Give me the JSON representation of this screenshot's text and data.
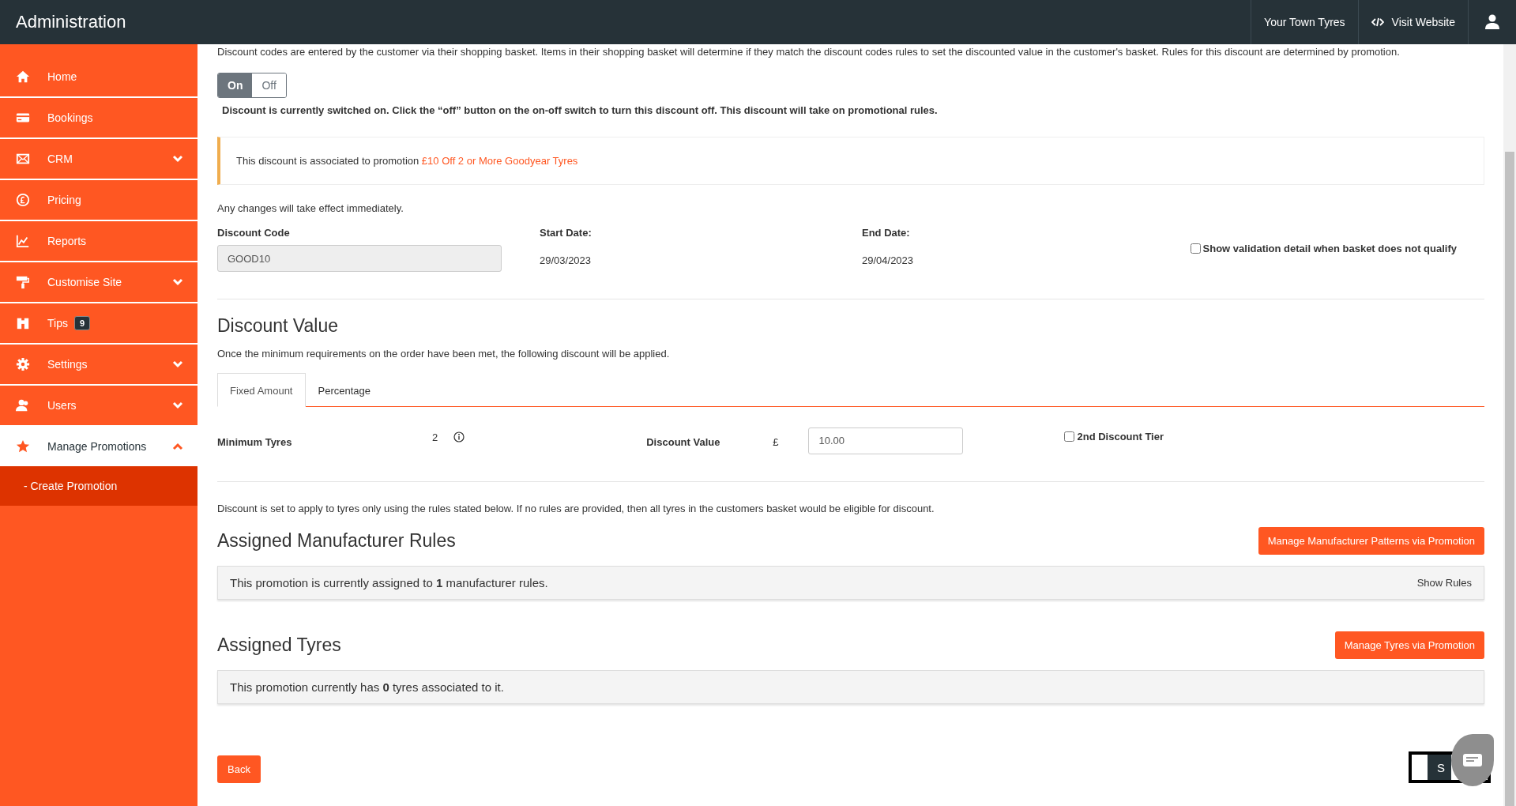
{
  "header": {
    "title": "Administration",
    "links": [
      {
        "label": "Your Town Tyres"
      },
      {
        "label": "Visit Website"
      }
    ]
  },
  "sidebar": [
    {
      "label": "Home",
      "selected": false
    },
    {
      "label": "Bookings",
      "selected": false
    },
    {
      "label": "CRM",
      "selected": false,
      "expanded": false
    },
    {
      "label": "Pricing",
      "selected": false
    },
    {
      "label": "Reports",
      "selected": false
    },
    {
      "label": "Customise Site",
      "selected": false,
      "expanded": false
    },
    {
      "label": "Tips",
      "selected": false,
      "badge": "9"
    },
    {
      "label": "Settings",
      "selected": false,
      "expanded": false
    },
    {
      "label": "Users",
      "selected": false,
      "expanded": false
    },
    {
      "label": "Manage Promotions",
      "selected": true,
      "expanded": true,
      "children": [
        {
          "label": "- Create Promotion",
          "selected": true
        }
      ]
    }
  ],
  "intro": "Discount codes are entered by the customer via their shopping basket. Items in their shopping basket will determine if they match the discount codes rules to set the discounted value in the customer's basket. Rules for this discount are determined by promotion.",
  "toggle": [
    {
      "label": "On",
      "selected": true
    },
    {
      "label": "Off",
      "selected": false
    }
  ],
  "toggle_note": "Discount is currently switched on. Click the “off” button on the on-off switch to turn this discount off. This discount will take on promotional rules.",
  "alert": {
    "text": "This discount is associated to promotion",
    "link": "£10 Off 2 or More Goodyear Tyres"
  },
  "changes_note": "Any changes will take effect immediately.",
  "discount_code": {
    "label": "Discount Code",
    "value": "GOOD10"
  },
  "start_date": {
    "label": "Start Date:",
    "value": "29/03/2023"
  },
  "end_date": {
    "label": "End Date:",
    "value": "29/04/2023"
  },
  "validation_checkbox": {
    "label": "Show validation detail when basket does not qualify",
    "checked": false
  },
  "discount_value": {
    "title": "Discount Value",
    "description": "Once the minimum requirements on the order have been met, the following discount will be applied.",
    "tabs": [
      {
        "label": "Fixed Amount",
        "selected": true
      },
      {
        "label": "Percentage",
        "selected": false
      }
    ],
    "minimum_tyres": {
      "label": "Minimum Tyres",
      "value": "2"
    },
    "value_field": {
      "label": "Discount Value",
      "currency": "£",
      "value": "10.00"
    },
    "second_tier": {
      "label": "2nd Discount Tier",
      "checked": false
    }
  },
  "rules_note": "Discount is set to apply to tyres only using the rules stated below. If no rules are provided, then all tyres in the customers basket would be eligible for discount.",
  "sections": [
    {
      "title": "Assigned Manufacturer Rules",
      "button": "Manage Manufacturer Patterns via Promotion",
      "summary": "This promotion is currently assigned to **1** manufacturer rules.",
      "action": "Show Rules"
    },
    {
      "title": "Assigned Tyres",
      "button": "Manage Tyres via Promotion",
      "summary": "This promotion currently has **0** tyres associated to it."
    }
  ],
  "footer": {
    "back": "Back",
    "save": "S"
  }
}
